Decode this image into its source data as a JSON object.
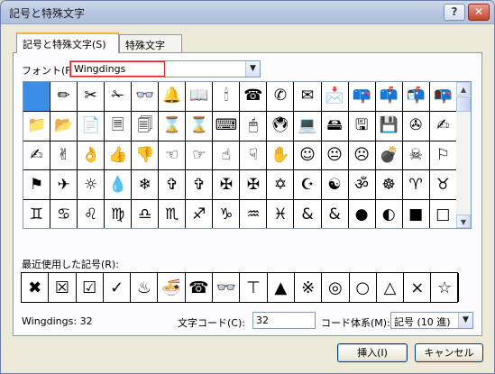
{
  "title": "記号と特殊文字",
  "titlebar": {
    "help": "?",
    "close": "✕"
  },
  "tabs": [
    {
      "label": "記号と特殊文字(S)"
    },
    {
      "label": "特殊文字(P)"
    }
  ],
  "font": {
    "label": "フォント(F):",
    "value": "Wingdings"
  },
  "grid": {
    "selected_index": 0,
    "rows": [
      [
        "",
        "✏",
        "✂",
        "✁",
        "👓",
        "🔔",
        "📖",
        "🕯",
        "☎",
        "✆",
        "✉",
        "📩",
        "📪",
        "📫",
        "📬",
        "📭"
      ],
      [
        "📁",
        "📂",
        "📄",
        "🗏",
        "🗐",
        "⌛",
        "⌛",
        "⌨",
        "🖱",
        "🖲",
        "💻",
        "🖴",
        "🖫",
        "💾",
        "✇",
        "✍"
      ],
      [
        "✍",
        "✌",
        "👌",
        "👍",
        "👎",
        "☜",
        "☞",
        "☝",
        "☟",
        "✋",
        "☺",
        "😐",
        "☹",
        "💣",
        "☠",
        "⚐"
      ],
      [
        "⚑",
        "✈",
        "☼",
        "💧",
        "❄",
        "✞",
        "✞",
        "✠",
        "✠",
        "✡",
        "☪",
        "☯",
        "ॐ",
        "☸",
        "♈",
        "♉"
      ],
      [
        "♊",
        "♋",
        "♌",
        "♍",
        "♎",
        "♏",
        "♐",
        "♑",
        "♒",
        "♓",
        "&",
        "&",
        "●",
        "◐",
        "■",
        "□"
      ]
    ]
  },
  "recent": {
    "label": "最近使用した記号(R):",
    "items": [
      "✖",
      "☒",
      "☑",
      "✓",
      "♨",
      "🍜",
      "☎",
      "👓",
      "⊤",
      "▲",
      "※",
      "◎",
      "○",
      "△",
      "×",
      "☆"
    ]
  },
  "status": {
    "text": "Wingdings: 32"
  },
  "code": {
    "label": "文字コード(C):",
    "value": "32"
  },
  "system": {
    "label": "コード体系(M):",
    "value": "記号 (10 進)"
  },
  "buttons": {
    "insert": "挿入(I)",
    "cancel": "キャンセル"
  },
  "icons": {
    "dropdown": "▼",
    "scroll_up": "▲",
    "scroll_down": "▼"
  },
  "colors": {
    "selection": "#3a8ee6",
    "font_highlight": "#e02020",
    "default_border": "#003c74"
  }
}
